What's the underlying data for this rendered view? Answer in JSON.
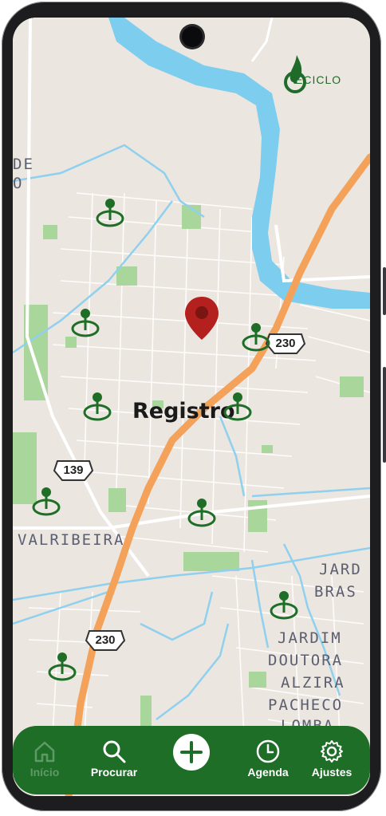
{
  "app": {
    "logo_text": "ECICLO"
  },
  "map": {
    "city_label": "Registro",
    "area_labels": [
      "DE",
      "O",
      "VALRIBEIRA",
      "JARD",
      "BRAS",
      "JARDIM",
      "DOUTORA",
      "ALZIRA",
      "PACHECO",
      "LOMBA"
    ],
    "highway_shields": [
      "230",
      "139",
      "230"
    ],
    "colors": {
      "water": "#7ccdee",
      "highway": "#f4a25a",
      "park": "#a9d79b",
      "land": "#ebe6df",
      "pin": "#1f6e28",
      "user_pin": "#b3201e"
    }
  },
  "nav": {
    "items": [
      {
        "label": "Início",
        "icon": "home-icon"
      },
      {
        "label": "Procurar",
        "icon": "search-icon"
      },
      {
        "label": "",
        "icon": "plus-icon"
      },
      {
        "label": "Agenda",
        "icon": "clock-icon"
      },
      {
        "label": "Ajustes",
        "icon": "gear-icon"
      }
    ]
  }
}
